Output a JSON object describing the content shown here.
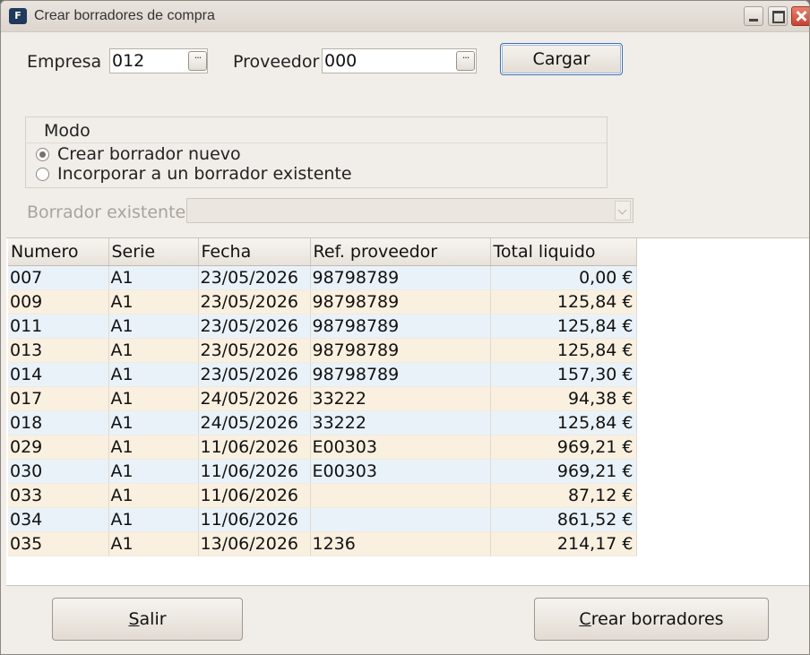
{
  "window": {
    "title": "Crear borradores de compra",
    "icon_letter": "F"
  },
  "form": {
    "empresa_label": "Empresa",
    "empresa_value": "012",
    "proveedor_label": "Proveedor",
    "proveedor_value": "000",
    "cargar_label": "Cargar",
    "ellipsis": "···"
  },
  "modo": {
    "title": "Modo",
    "option_new": "Crear borrador nuevo",
    "option_existing": "Incorporar a un borrador existente",
    "selected": "new"
  },
  "borrador_existente_label": "Borrador existente",
  "table": {
    "headers": [
      "Numero",
      "Serie",
      "Fecha",
      "Ref. proveedor",
      "Total liquido"
    ],
    "rows": [
      [
        "007",
        "A1",
        "23/05/2026",
        "98798789",
        "0,00 €"
      ],
      [
        "009",
        "A1",
        "23/05/2026",
        "98798789",
        "125,84 €"
      ],
      [
        "011",
        "A1",
        "23/05/2026",
        "98798789",
        "125,84 €"
      ],
      [
        "013",
        "A1",
        "23/05/2026",
        "98798789",
        "125,84 €"
      ],
      [
        "014",
        "A1",
        "23/05/2026",
        "98798789",
        "157,30 €"
      ],
      [
        "017",
        "A1",
        "24/05/2026",
        "33222",
        "94,38 €"
      ],
      [
        "018",
        "A1",
        "24/05/2026",
        "33222",
        "125,84 €"
      ],
      [
        "029",
        "A1",
        "11/06/2026",
        "E00303",
        "969,21 €"
      ],
      [
        "030",
        "A1",
        "11/06/2026",
        "E00303",
        "969,21 €"
      ],
      [
        "033",
        "A1",
        "11/06/2026",
        "",
        "87,12 €"
      ],
      [
        "034",
        "A1",
        "11/06/2026",
        "",
        "861,52 €"
      ],
      [
        "035",
        "A1",
        "13/06/2026",
        "1236",
        "214,17 €"
      ]
    ]
  },
  "footer": {
    "salir_first": "S",
    "salir_rest": "alir",
    "crear_first": "C",
    "crear_rest": "rear borradores"
  },
  "icons": [
    "app-icon",
    "minimize-icon",
    "maximize-icon",
    "close-icon",
    "ellipsis-icon",
    "chevron-down-icon"
  ]
}
